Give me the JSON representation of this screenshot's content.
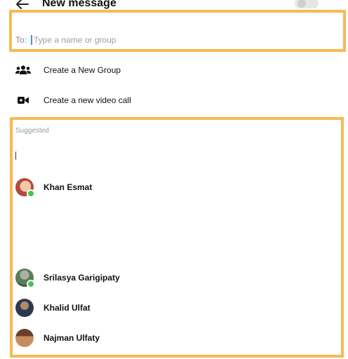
{
  "header": {
    "title": "New message",
    "back_icon": "arrow-left-icon"
  },
  "to_field": {
    "label": "To:",
    "placeholder": "Type a name or group",
    "value": ""
  },
  "actions": [
    {
      "label": "Create a New Group",
      "icon": "group-icon"
    },
    {
      "label": "Create a new video call",
      "icon": "video-camera-icon"
    }
  ],
  "suggested": {
    "header": "Suggested",
    "contacts": [
      {
        "name": "Khan Esmat",
        "online": true
      },
      {
        "name": "Srilasya Garigipaty",
        "online": true
      },
      {
        "name": "Khalid Ulfat",
        "online": false
      },
      {
        "name": "Najman Ulfaty",
        "online": false
      }
    ]
  },
  "colors": {
    "highlight": "#f7b955",
    "online": "#44c553",
    "caret": "#4a90e2"
  }
}
